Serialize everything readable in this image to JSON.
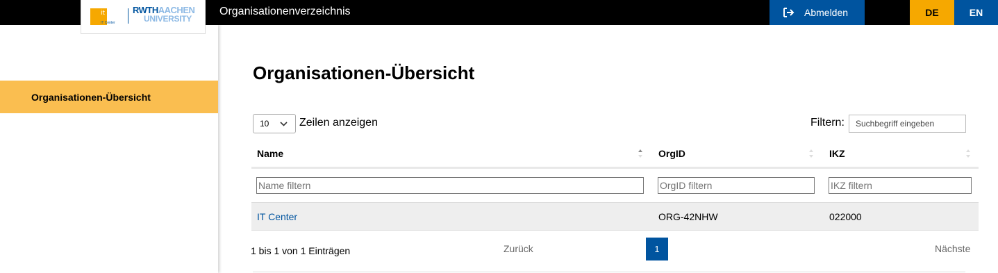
{
  "header": {
    "logo": {
      "it_text": "it",
      "itc_label": "IT Center",
      "rwth": "RWTH",
      "aachen": "AACHEN",
      "university": "UNIVERSITY"
    },
    "app_title": "Organisationenverzeichnis",
    "logout_label": "Abmelden",
    "lang_de": "DE",
    "lang_en": "EN"
  },
  "sidebar": {
    "items": [
      {
        "label": "Organisationen-Übersicht",
        "active": true
      }
    ]
  },
  "main": {
    "title": "Organisationen-Übersicht",
    "length": {
      "value": "10",
      "label": "Zeilen anzeigen"
    },
    "filter": {
      "label": "Filtern:",
      "placeholder": "Suchbegriff eingeben"
    },
    "table": {
      "columns": [
        {
          "label": "Name",
          "filter_placeholder": "Name filtern"
        },
        {
          "label": "OrgID",
          "filter_placeholder": "OrgID filtern"
        },
        {
          "label": "IKZ",
          "filter_placeholder": "IKZ filtern"
        }
      ],
      "rows": [
        {
          "name": "IT Center",
          "orgid": "ORG-42NHW",
          "ikz": "022000"
        }
      ]
    },
    "pagination": {
      "info": "1 bis 1 von 1 Einträgen",
      "prev": "Zurück",
      "current_page": "1",
      "next": "Nächste"
    }
  },
  "colors": {
    "brand_blue": "#00549f",
    "accent_yellow": "#f6a800",
    "sidebar_active": "#fabe50"
  },
  "icons": [
    "logout-icon",
    "chevron-down-icon",
    "sort-icon"
  ]
}
